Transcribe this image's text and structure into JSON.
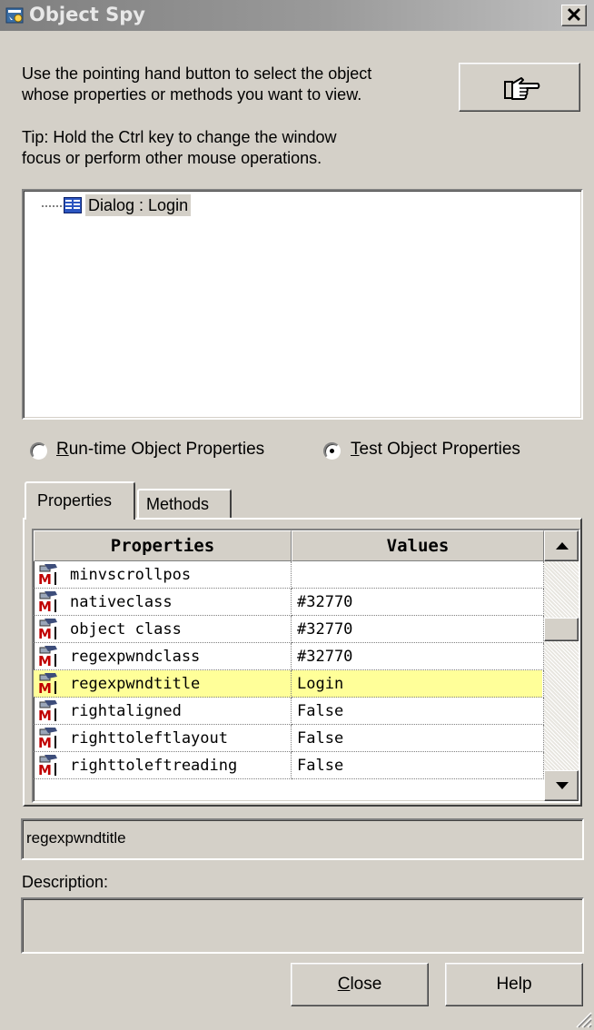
{
  "window": {
    "title": "Object Spy",
    "close_glyph": "✕",
    "title_icon": "object-spy-app-icon"
  },
  "instructions": {
    "line1": "Use the pointing hand button to select the object",
    "line2": "whose properties or methods you want to view.",
    "tip1": "Tip: Hold the Ctrl key to change the window",
    "tip2": "focus or perform other mouse operations."
  },
  "pointer_button": {
    "icon": "pointing-hand-icon"
  },
  "tree": {
    "items": [
      {
        "label": "Dialog : Login",
        "icon": "dialog-icon",
        "selected": true
      }
    ]
  },
  "mode": {
    "runtime_prefix": "",
    "runtime_key": "R",
    "runtime_rest": "un-time Object Properties",
    "test_key": "T",
    "test_rest": "est Object Properties",
    "selected": "test"
  },
  "tabs": [
    {
      "label": "Properties",
      "active": true
    },
    {
      "label": "Methods",
      "active": false
    }
  ],
  "grid": {
    "headers": [
      "Properties",
      "Values"
    ],
    "rows": [
      {
        "name": "minvscrollpos",
        "value": ""
      },
      {
        "name": "nativeclass",
        "value": "#32770"
      },
      {
        "name": "object class",
        "value": "#32770"
      },
      {
        "name": "regexpwndclass",
        "value": "#32770"
      },
      {
        "name": "regexpwndtitle",
        "value": "Login",
        "highlighted": true
      },
      {
        "name": "rightaligned",
        "value": "False"
      },
      {
        "name": "righttoleftlayout",
        "value": "False"
      },
      {
        "name": "righttoleftreading",
        "value": "False"
      }
    ],
    "highlight_color": "#ffff99"
  },
  "selected_property": "regexpwndtitle",
  "description": {
    "label": "Description:",
    "value": ""
  },
  "buttons": {
    "close_key": "C",
    "close_rest": "lose",
    "help": "Help"
  }
}
